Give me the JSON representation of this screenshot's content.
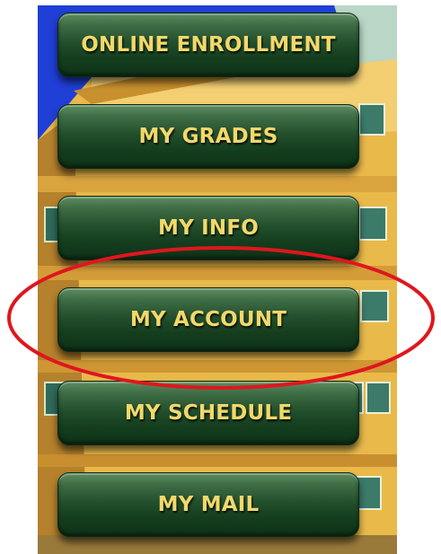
{
  "menu": {
    "items": [
      {
        "label": "ONLINE ENROLLMENT"
      },
      {
        "label": "MY GRADES"
      },
      {
        "label": "MY INFO"
      },
      {
        "label": "MY ACCOUNT"
      },
      {
        "label": "MY SCHEDULE"
      },
      {
        "label": "MY MAIL"
      }
    ],
    "highlighted_item": "MY ACCOUNT"
  },
  "colors": {
    "button_text": "#f2d86b",
    "button_fill": "#214e2b",
    "highlight_ring": "#e0161e",
    "building_wall": "#e9b94a",
    "sky": "#1f3fd6"
  }
}
